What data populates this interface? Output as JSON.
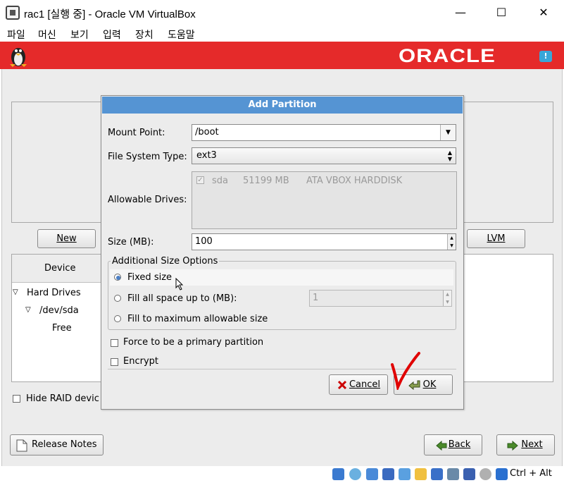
{
  "window": {
    "title": "rac1 [실행 중] - Oracle VM VirtualBox",
    "minimize": "—",
    "maximize": "☐",
    "close": "✕"
  },
  "menu": [
    "파일",
    "머신",
    "보기",
    "입력",
    "장치",
    "도움말"
  ],
  "banner": {
    "logo": "ORACLE"
  },
  "installer": {
    "new_button": "New",
    "lvm_button": "LVM",
    "device_header": "Device",
    "tree": [
      {
        "label": "Hard Drives",
        "level": 0,
        "expanded": true
      },
      {
        "label": "/dev/sda",
        "level": 1,
        "expanded": true
      },
      {
        "label": "Free",
        "level": 2
      }
    ],
    "hide_raid": "Hide RAID devic",
    "release_notes": "Release Notes",
    "back": "Back",
    "next": "Next"
  },
  "dialog": {
    "title": "Add Partition",
    "mount_point_label": "Mount Point:",
    "mount_point_value": "/boot",
    "fs_type_label": "File System Type:",
    "fs_type_value": "ext3",
    "allowable_drives_label": "Allowable Drives:",
    "drive": {
      "name": "sda",
      "size": "51199 MB",
      "model": "ATA VBOX HARDDISK",
      "checked": true
    },
    "size_label": "Size (MB):",
    "size_value": "100",
    "additional_options_label": "Additional Size Options",
    "options": [
      {
        "label": "Fixed size",
        "selected": true
      },
      {
        "label": "Fill all space up to (MB):",
        "selected": false
      },
      {
        "label": "Fill to maximum allowable size",
        "selected": false
      }
    ],
    "fill_up_to_value": "1",
    "force_primary_label": "Force to be a primary partition",
    "encrypt_label": "Encrypt",
    "cancel": "Cancel",
    "ok": "OK"
  },
  "taskbar": {
    "hotkey": "Ctrl + Alt"
  },
  "colors": {
    "banner": "#e52a2a",
    "dialog_title": "#5594d3",
    "annotation": "#e00000"
  }
}
